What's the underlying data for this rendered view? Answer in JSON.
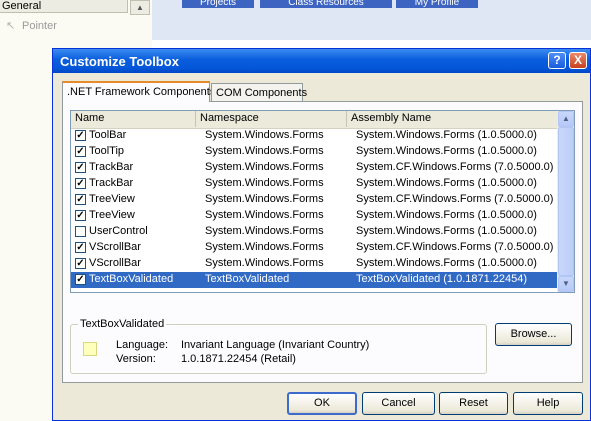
{
  "background": {
    "toolbox_header": "General",
    "toolbox_item": "Pointer",
    "tabs": [
      "Projects",
      "Class Resources",
      "My Profile"
    ]
  },
  "dialog": {
    "title": "Customize Toolbox",
    "help_glyph": "?",
    "close_glyph": "X",
    "tabs": [
      ".NET Framework Components",
      "COM Components"
    ],
    "columns": [
      "Name",
      "Namespace",
      "Assembly Name"
    ],
    "rows": [
      {
        "checked": true,
        "name": "ToolBar",
        "namespace": "System.Windows.Forms",
        "assembly": "System.Windows.Forms (1.0.5000.0)"
      },
      {
        "checked": true,
        "name": "ToolTip",
        "namespace": "System.Windows.Forms",
        "assembly": "System.Windows.Forms (1.0.5000.0)"
      },
      {
        "checked": true,
        "name": "TrackBar",
        "namespace": "System.Windows.Forms",
        "assembly": "System.CF.Windows.Forms (7.0.5000.0)"
      },
      {
        "checked": true,
        "name": "TrackBar",
        "namespace": "System.Windows.Forms",
        "assembly": "System.Windows.Forms (1.0.5000.0)"
      },
      {
        "checked": true,
        "name": "TreeView",
        "namespace": "System.Windows.Forms",
        "assembly": "System.CF.Windows.Forms (7.0.5000.0)"
      },
      {
        "checked": true,
        "name": "TreeView",
        "namespace": "System.Windows.Forms",
        "assembly": "System.Windows.Forms (1.0.5000.0)"
      },
      {
        "checked": false,
        "name": "UserControl",
        "namespace": "System.Windows.Forms",
        "assembly": "System.Windows.Forms (1.0.5000.0)"
      },
      {
        "checked": true,
        "name": "VScrollBar",
        "namespace": "System.Windows.Forms",
        "assembly": "System.CF.Windows.Forms (7.0.5000.0)"
      },
      {
        "checked": true,
        "name": "VScrollBar",
        "namespace": "System.Windows.Forms",
        "assembly": "System.Windows.Forms (1.0.5000.0)"
      },
      {
        "checked": true,
        "name": "TextBoxValidated",
        "namespace": "TextBoxValidated",
        "assembly": "TextBoxValidated (1.0.1871.22454)",
        "selected": true
      }
    ],
    "details": {
      "group_title": "TextBoxValidated",
      "language_label": "Language:",
      "language_value": "Invariant Language (Invariant Country)",
      "version_label": "Version:",
      "version_value": "1.0.1871.22454 (Retail)"
    },
    "buttons": {
      "browse": "Browse...",
      "ok": "OK",
      "cancel": "Cancel",
      "reset": "Reset",
      "help": "Help"
    }
  },
  "colors": {
    "selection": "#316ac5",
    "titlebar": "#0a5ddc",
    "dialog_face": "#ece9d8"
  }
}
